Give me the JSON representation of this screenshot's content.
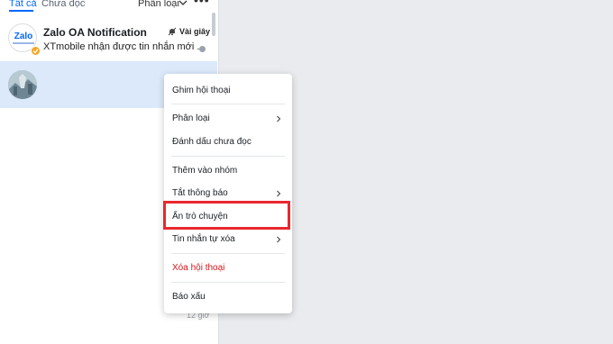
{
  "tabs": {
    "all": "Tất cả",
    "unread": "Chưa đọc",
    "filter": "Phân loại"
  },
  "icons": {
    "filter_chevron": "chevron-down-icon",
    "more": "more-icon",
    "mute": "mute-icon",
    "submenu": "chevron-right-icon"
  },
  "conversations": [
    {
      "name": "Zalo OA Notification",
      "avatar_text": "Zalo",
      "time": "Vài giây",
      "preview": "XTmobile nhận được tin nhắn mới ..."
    },
    {
      "name": "",
      "preview": ""
    }
  ],
  "peek_time": "12 giờ",
  "context_menu": {
    "pin": "Ghim hội thoại",
    "classify": "Phân loại",
    "mark_unread": "Đánh dấu chưa đọc",
    "add_to_group": "Thêm vào nhóm",
    "mute": "Tắt thông báo",
    "hide": "Ẩn trò chuyện",
    "auto_delete": "Tin nhắn tự xóa",
    "delete": "Xóa hội thoại",
    "report": "Báo xấu"
  },
  "colors": {
    "accent": "#0068ff",
    "selected_row": "#dbe9fb",
    "danger": "#d4181d",
    "highlight_box": "#e8282d"
  }
}
